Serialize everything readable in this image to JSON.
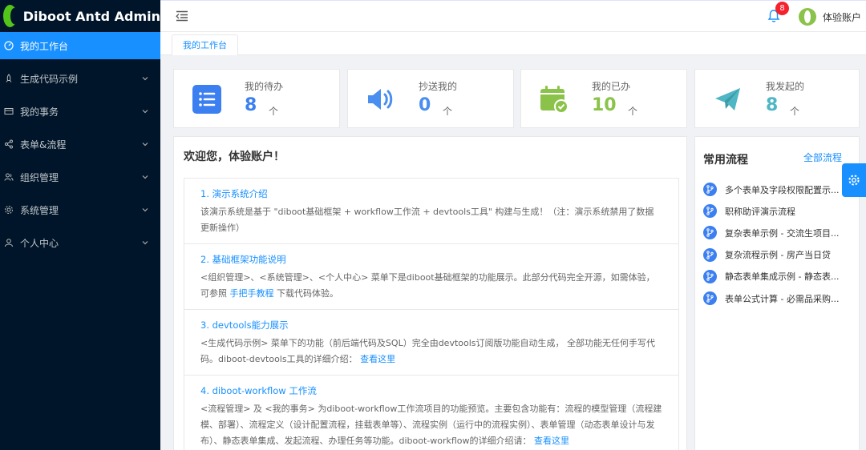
{
  "app": {
    "title": "Diboot Antd Admin"
  },
  "sidebar": {
    "items": [
      {
        "label": "我的工作台",
        "icon": "dashboard-icon",
        "active": true
      },
      {
        "label": "生成代码示例",
        "icon": "rocket-icon"
      },
      {
        "label": "我的事务",
        "icon": "credit-card-icon"
      },
      {
        "label": "表单&流程",
        "icon": "share-icon"
      },
      {
        "label": "组织管理",
        "icon": "team-icon"
      },
      {
        "label": "系统管理",
        "icon": "gear-icon"
      },
      {
        "label": "个人中心",
        "icon": "user-icon"
      }
    ]
  },
  "header": {
    "notification_count": "8",
    "user_name": "体验账户"
  },
  "tabs": [
    {
      "label": "我的工作台"
    }
  ],
  "stats": [
    {
      "label": "我的待办",
      "value": "8",
      "unit": "个",
      "color": "#3b7ff0",
      "icon": "list-icon"
    },
    {
      "label": "抄送我的",
      "value": "0",
      "unit": "个",
      "color": "#4a8ef0",
      "icon": "sound-icon"
    },
    {
      "label": "我的已办",
      "value": "10",
      "unit": "个",
      "color": "#8bc34a",
      "icon": "calendar-check-icon"
    },
    {
      "label": "我发起的",
      "value": "8",
      "unit": "个",
      "color": "#4fb6c4",
      "icon": "send-icon"
    }
  ],
  "welcome": {
    "title": "欢迎您，体验账户！",
    "sections": [
      {
        "heading": "1. 演示系统介绍",
        "body": "该演示系统是基于 \"diboot基础框架 + workflow工作流 + devtools工具\" 构建与生成！（注：演示系统禁用了数据更新操作）"
      },
      {
        "heading": "2. 基础框架功能说明",
        "body_before": "<组织管理>、<系统管理>、<个人中心> 菜单下是diboot基础框架的功能展示。此部分代码完全开源，如需体验，可参照 ",
        "link": "手把手教程",
        "body_after": " 下载代码体验。"
      },
      {
        "heading": "3. devtools能力展示",
        "body_before": "<生成代码示例> 菜单下的功能（前后端代码及SQL）完全由devtools订阅版功能自动生成， 全部功能无任何手写代码。diboot-devtools工具的详细介绍：  ",
        "link": "查看这里",
        "body_after": ""
      },
      {
        "heading": "4. diboot-workflow 工作流",
        "body_before": "<流程管理> 及 <我的事务> 为diboot-workflow工作流项目的功能预览。主要包含功能有：流程的模型管理（流程建模、部署）、流程定义（设计配置流程，挂载表单等）、流程实例（运行中的流程实例）、表单管理（动态表单设计与发布）、静态表单集成、发起流程、办理任务等功能。diboot-workflow的详细介绍请：  ",
        "link": "查看这里",
        "body_after": ""
      }
    ]
  },
  "process": {
    "title": "常用流程",
    "all_label": "全部流程",
    "items": [
      "多个表单及字段权限配置示...",
      "职称助评演示流程",
      "复杂表单示例 - 交流生项目...",
      "复杂流程示例 - 房产当日贷",
      "静态表单集成示例 - 静态表...",
      "表单公式计算 - 必需品采购..."
    ]
  },
  "colors": {
    "primary": "#1890ff",
    "sidebar_bg": "#001529",
    "badge": "#f5222d"
  }
}
